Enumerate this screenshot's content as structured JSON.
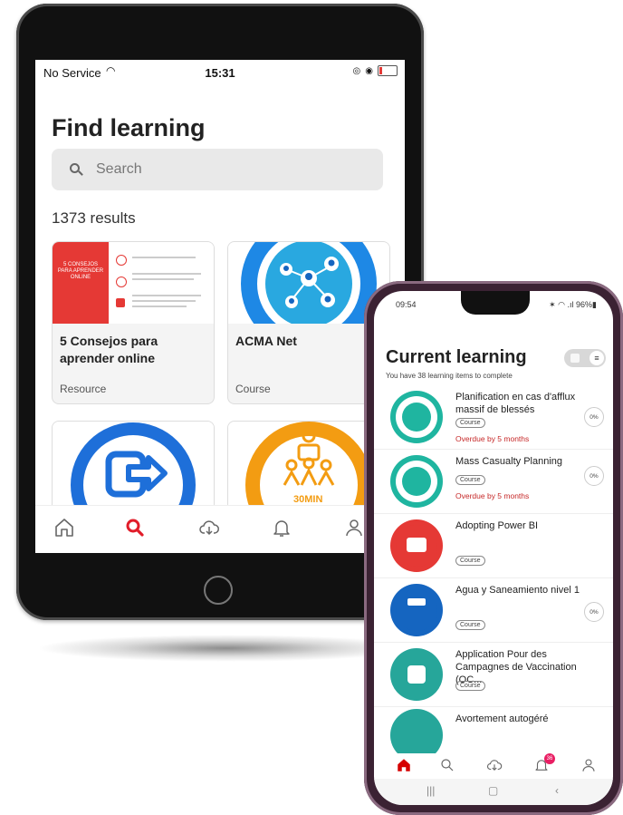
{
  "tablet": {
    "status": {
      "carrier": "No Service",
      "time": "15:31"
    },
    "title": "Find learning",
    "search": {
      "placeholder": "Search"
    },
    "results": "1373 results",
    "cards": [
      {
        "title": "5 Consejos para aprender online",
        "type": "Resource",
        "thumb_text": "5 CONSEJOS PARA APRENDER ONLINE"
      },
      {
        "title": "ACMA Net",
        "type": "Course"
      },
      {
        "title": "",
        "type": ""
      },
      {
        "title": "",
        "type": "",
        "thumb_text": "30MIN"
      }
    ],
    "nav": [
      "home-icon",
      "search-icon",
      "download-icon",
      "bell-icon",
      "profile-icon"
    ],
    "accent": "#e11d2a"
  },
  "phone": {
    "status": {
      "time": "09:54",
      "battery": "96%"
    },
    "title": "Current learning",
    "subtitle": "You have 38 learning items to complete",
    "items": [
      {
        "title": "Planification en cas d'afflux massif de blessés",
        "chip": "Course",
        "overdue": "Overdue by 5 months",
        "progress": "0%",
        "color": "#1fb5a0"
      },
      {
        "title": "Mass Casualty Planning",
        "chip": "Course",
        "overdue": "Overdue by 5 months",
        "progress": "0%",
        "color": "#1fb5a0"
      },
      {
        "title": "Adopting Power BI",
        "chip": "Course",
        "overdue": "",
        "progress": "",
        "color": "#e53935"
      },
      {
        "title": "Agua y Saneamiento nivel 1",
        "chip": "Course",
        "overdue": "",
        "progress": "0%",
        "color": "#1565c0"
      },
      {
        "title": "Application Pour des Campagnes de Vaccination (OC...",
        "chip": "Course",
        "overdue": "",
        "progress": "",
        "color": "#26a69a"
      },
      {
        "title": "Avortement autogéré",
        "chip": "",
        "overdue": "",
        "progress": "",
        "color": "#26a69a"
      }
    ],
    "notification_count": "36",
    "accent": "#d50000"
  }
}
